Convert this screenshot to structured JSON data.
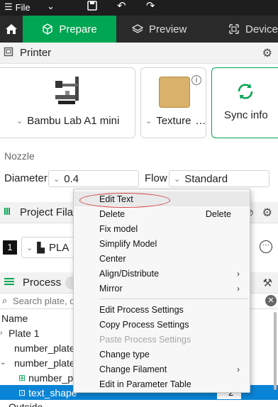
{
  "titlebar": {
    "file_label": "File"
  },
  "tabs": {
    "prepare": "Prepare",
    "preview": "Preview",
    "device": "Device"
  },
  "printer": {
    "header": "Printer",
    "printer_name": "Bambu Lab A1 mini",
    "plate_name": "Texture",
    "plate_name_suffix": "…",
    "sync_label": "Sync info"
  },
  "nozzle": {
    "label": "Nozzle",
    "diameter_label": "Diameter",
    "diameter_value": "0.4",
    "flow_label": "Flow",
    "flow_value": "Standard"
  },
  "filament": {
    "header": "Project Fila",
    "slot_number": "1",
    "material": "PLA"
  },
  "process": {
    "header": "Process",
    "search_placeholder": "Search plate, ob"
  },
  "tree": {
    "col_name": "Name",
    "rows": [
      {
        "label": "Plate 1"
      },
      {
        "label": "number_plate"
      },
      {
        "label": "number_plate"
      },
      {
        "label": "number_p"
      },
      {
        "label": "text_shape",
        "count": "2"
      },
      {
        "label": "Outside"
      }
    ]
  },
  "context_menu": {
    "items": [
      {
        "label": "Edit Text"
      },
      {
        "label": "Delete",
        "shortcut": "Delete"
      },
      {
        "label": "Fix model"
      },
      {
        "label": "Simplify Model"
      },
      {
        "label": "Center"
      },
      {
        "label": "Align/Distribute",
        "submenu": true
      },
      {
        "label": "Mirror",
        "submenu": true
      },
      {
        "label": "Edit Process Settings"
      },
      {
        "label": "Copy Process Settings"
      },
      {
        "label": "Paste Process Settings",
        "disabled": true
      },
      {
        "label": "Change type"
      },
      {
        "label": "Change Filament",
        "submenu": true
      },
      {
        "label": "Edit in Parameter Table"
      }
    ]
  },
  "colors": {
    "accent": "#00a651",
    "selection": "#0a84d6",
    "annotation": "#d23b3b"
  }
}
